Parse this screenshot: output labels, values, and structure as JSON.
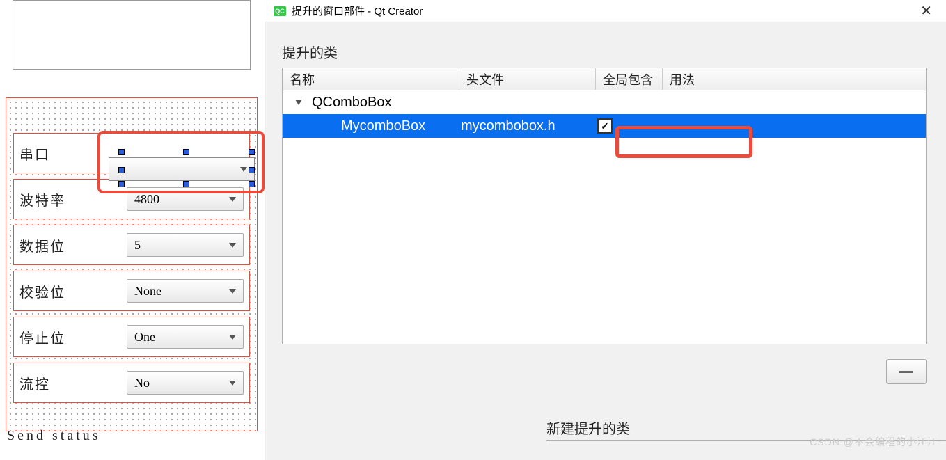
{
  "dialog": {
    "app_icon_text": "QC",
    "title": "提升的窗口部件 - Qt Creator",
    "close_glyph": "✕",
    "section_label": "提升的类",
    "new_section_label": "新建提升的类",
    "columns": {
      "name": "名称",
      "header_file": "头文件",
      "global_include": "全局包含",
      "usage": "用法"
    },
    "tree": {
      "parent": "QComboBox",
      "child": {
        "name": "MycomboBox",
        "header": "mycombobox.h",
        "global_include_checked": "✓"
      }
    },
    "minus_tooltip": "—"
  },
  "designer": {
    "send_status": "Send status",
    "rows": [
      {
        "label": "串口",
        "value": ""
      },
      {
        "label": "波特率",
        "value": "4800"
      },
      {
        "label": "数据位",
        "value": "5"
      },
      {
        "label": "校验位",
        "value": "None"
      },
      {
        "label": "停止位",
        "value": "One"
      },
      {
        "label": "流控",
        "value": "No"
      }
    ]
  },
  "watermark": "CSDN @不会编程的小江江"
}
